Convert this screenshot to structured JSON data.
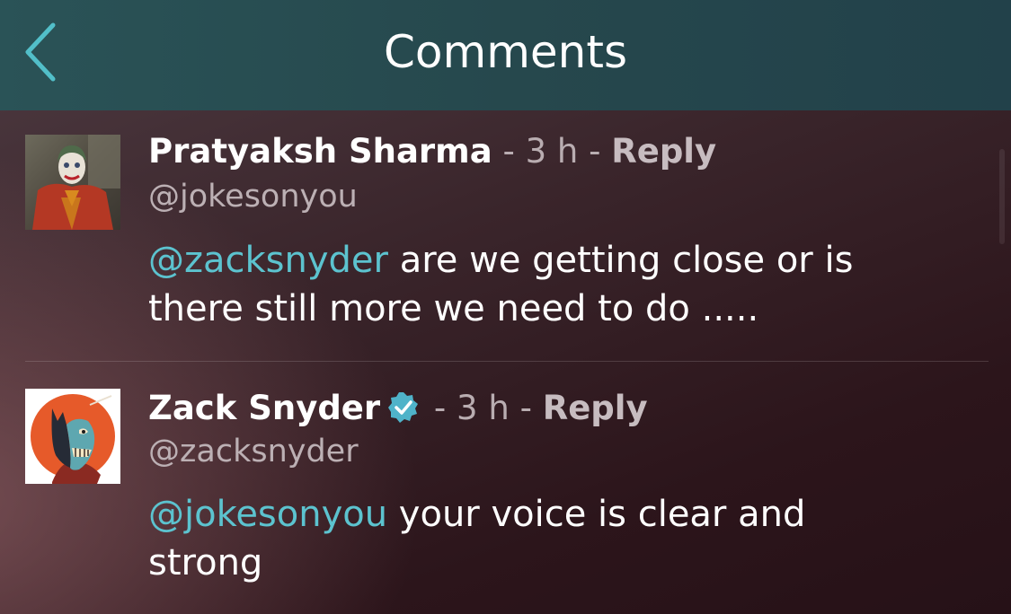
{
  "header": {
    "title": "Comments",
    "back_icon": "chevron-left-icon"
  },
  "colors": {
    "header_bg": "#26484d",
    "accent": "#5cc3cf",
    "mention": "#5cc3cf",
    "verified": "#4fb3c9"
  },
  "comments": [
    {
      "author": "Pratyaksh Sharma",
      "verified": false,
      "separator": "-",
      "time": "3 h",
      "reply_label": "Reply",
      "handle": "@jokesonyou",
      "mention": "@zacksnyder",
      "line1_rest": " are we getting close or is",
      "line2": "there still more we need to do .....",
      "avatar_icon": "joker-avatar"
    },
    {
      "author": "Zack Snyder",
      "verified": true,
      "verified_icon": "verified-badge-icon",
      "separator": "-",
      "time": "3 h",
      "reply_label": "Reply",
      "handle": "@zacksnyder",
      "mention": "@jokesonyou",
      "line1_rest": " your voice is clear and",
      "line2": "strong",
      "avatar_icon": "batman-zombie-avatar"
    }
  ]
}
